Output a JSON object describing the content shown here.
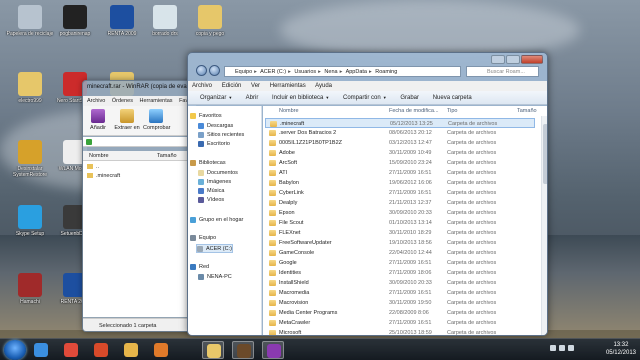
{
  "desktop": {
    "icons": [
      {
        "label": "Papelera de reciclaje",
        "color": "#b7c3cf"
      },
      {
        "label": "pogbanirenap",
        "color": "#222222"
      },
      {
        "label": "RENTA 2009",
        "color": "#1d4fa0"
      },
      {
        "label": "borrado drs",
        "color": "#d8e4ea"
      },
      {
        "label": "copia y pego",
        "color": "#e6c76a"
      },
      {
        "label": "electro999",
        "color": "#e6c76a"
      },
      {
        "label": "Nero StartSmart",
        "color": "#cc2b2b"
      },
      {
        "label": "",
        "color": "#e6c76a"
      },
      {
        "label": "Desinstalar SystemRestore",
        "color": "#d6a12a"
      },
      {
        "label": "WLAN Monitor",
        "color": "#eeeeee"
      },
      {
        "label": "Skype Setup",
        "color": "#2a9fe0"
      },
      {
        "label": "SetuenbDion",
        "color": "#3a3a3a"
      },
      {
        "label": "Hamachi",
        "color": "#a02a2a"
      },
      {
        "label": "RENTA 2008",
        "color": "#1d4fa0"
      }
    ]
  },
  "winrar": {
    "title": "minecraft.rar - WinRAR (copia de eval...",
    "menu": [
      "Archivo",
      "Órdenes",
      "Herramientas",
      "Fav"
    ],
    "tools": [
      "Añadir",
      "Extraer en",
      "Comprobar"
    ],
    "columns": [
      "Nombre",
      "Tamaño"
    ],
    "rows": [
      "..",
      ".minecraft"
    ],
    "status": "Seleccionado 1 carpeta"
  },
  "explorer": {
    "address": [
      "Equipo",
      "ACER (C:)",
      "Usuarios",
      "Nena",
      "AppData",
      "Roaming"
    ],
    "search_placeholder": "Buscar Roam...",
    "menu": [
      "Archivo",
      "Edición",
      "Ver",
      "Herramientas",
      "Ayuda"
    ],
    "toolbar": [
      "Organizar",
      "Abrir",
      "Incluir en biblioteca",
      "Compartir con",
      "Grabar",
      "Nueva carpeta"
    ],
    "nav": {
      "favorites_header": "Favoritos",
      "favorites": [
        "Descargas",
        "Sitios recientes",
        "Escritorio"
      ],
      "libraries_header": "Bibliotecas",
      "libraries": [
        "Documentos",
        "Imágenes",
        "Música",
        "Vídeos"
      ],
      "homegroup": "Grupo en el hogar",
      "computer_header": "Equipo",
      "computer": [
        "ACER (C:)"
      ],
      "network_header": "Red",
      "network": [
        "NENA-PC"
      ]
    },
    "columns": {
      "name": "Nombre",
      "date": "Fecha de modifica...",
      "type": "Tipo",
      "size": "Tamaño"
    },
    "files": [
      {
        "name": ".minecraft",
        "date": "05/12/2013 13:25",
        "type": "Carpeta de archivos"
      },
      {
        "name": ".server Dos Batracios 2",
        "date": "08/06/2013 20:12",
        "type": "Carpeta de archivos"
      },
      {
        "name": "0005IL1Z21P1B0TP1B2Z",
        "date": "03/12/2013 12:47",
        "type": "Carpeta de archivos"
      },
      {
        "name": "Adobe",
        "date": "30/11/2009 10:49",
        "type": "Carpeta de archivos"
      },
      {
        "name": "ArcSoft",
        "date": "15/09/2010 23:24",
        "type": "Carpeta de archivos"
      },
      {
        "name": "ATI",
        "date": "27/11/2009 16:51",
        "type": "Carpeta de archivos"
      },
      {
        "name": "Babylon",
        "date": "19/06/2012 16:06",
        "type": "Carpeta de archivos"
      },
      {
        "name": "CyberLink",
        "date": "27/11/2009 16:51",
        "type": "Carpeta de archivos"
      },
      {
        "name": "Dealply",
        "date": "21/11/2013 12:37",
        "type": "Carpeta de archivos"
      },
      {
        "name": "Epson",
        "date": "30/09/2010 20:33",
        "type": "Carpeta de archivos"
      },
      {
        "name": "File Scout",
        "date": "01/10/2013 13:14",
        "type": "Carpeta de archivos"
      },
      {
        "name": "FLEXnet",
        "date": "30/11/2010 18:29",
        "type": "Carpeta de archivos"
      },
      {
        "name": "FreeSoftwareUpdater",
        "date": "19/10/2013 18:56",
        "type": "Carpeta de archivos"
      },
      {
        "name": "GameConsole",
        "date": "22/04/2010 12:44",
        "type": "Carpeta de archivos"
      },
      {
        "name": "Google",
        "date": "27/11/2009 16:51",
        "type": "Carpeta de archivos"
      },
      {
        "name": "Identities",
        "date": "27/11/2009 18:06",
        "type": "Carpeta de archivos"
      },
      {
        "name": "InstallShield",
        "date": "30/09/2010 20:33",
        "type": "Carpeta de archivos"
      },
      {
        "name": "Macromedia",
        "date": "27/11/2009 16:51",
        "type": "Carpeta de archivos"
      },
      {
        "name": "Macrovision",
        "date": "30/11/2009 19:50",
        "type": "Carpeta de archivos"
      },
      {
        "name": "Media Center Programs",
        "date": "22/08/2009 8:06",
        "type": "Carpeta de archivos"
      },
      {
        "name": "MetaCrawler",
        "date": "27/11/2009 16:51",
        "type": "Carpeta de archivos"
      },
      {
        "name": "Microsoft",
        "date": "25/10/2013 18:59",
        "type": "Carpeta de archivos"
      }
    ]
  },
  "taskbar": {
    "apps": [
      {
        "name": "ie-icon",
        "color": "#3b8fe0"
      },
      {
        "name": "chrome-icon",
        "color": "#e04a3a"
      },
      {
        "name": "windows-update-icon",
        "color": "#d84a2a"
      },
      {
        "name": "explorer-folder-icon",
        "color": "#e6b54a"
      },
      {
        "name": "firefox-icon",
        "color": "#e07a2a"
      },
      {
        "name": "explorer-icon",
        "color": "#e8c86a"
      },
      {
        "name": "minecraft-icon",
        "color": "#6b4a2a"
      },
      {
        "name": "winrar-icon",
        "color": "#8a3ab0"
      }
    ],
    "time": "13:32",
    "date": "05/12/2013"
  }
}
